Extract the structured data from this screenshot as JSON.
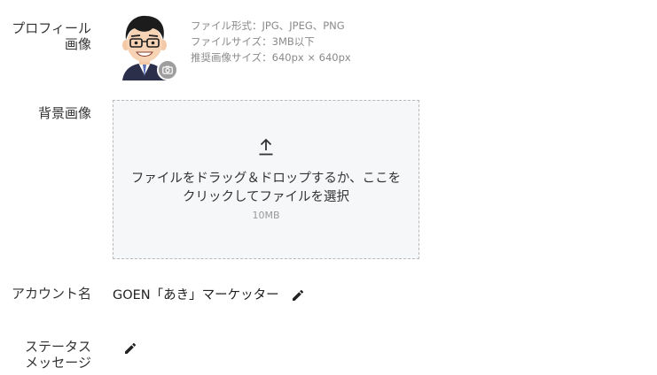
{
  "profile": {
    "label_line1": "プロフィール",
    "label_line2": "画像",
    "file_format": "ファイル形式：JPG、JPEG、PNG",
    "file_size": "ファイルサイズ：3MB以下",
    "recommended_size": "推奨画像サイズ：640px × 640px"
  },
  "background": {
    "label": "背景画像",
    "drop_text": "ファイルをドラッグ＆ドロップするか、ここをクリックしてファイルを選択",
    "max_size": "10MB"
  },
  "account": {
    "label": "アカウント名",
    "value": "GOEN「あき」マーケッター"
  },
  "status": {
    "label_line1": "ステータス",
    "label_line2": "メッセージ",
    "value": ""
  },
  "icons": {
    "camera": "camera-icon",
    "upload": "upload-icon",
    "edit": "pencil-icon"
  },
  "colors": {
    "dropzone_bg": "#f6f7f9",
    "dropzone_border": "#b8b8b8",
    "secondary_text": "#8a8a8a",
    "camera_badge": "#9e9e9e"
  }
}
